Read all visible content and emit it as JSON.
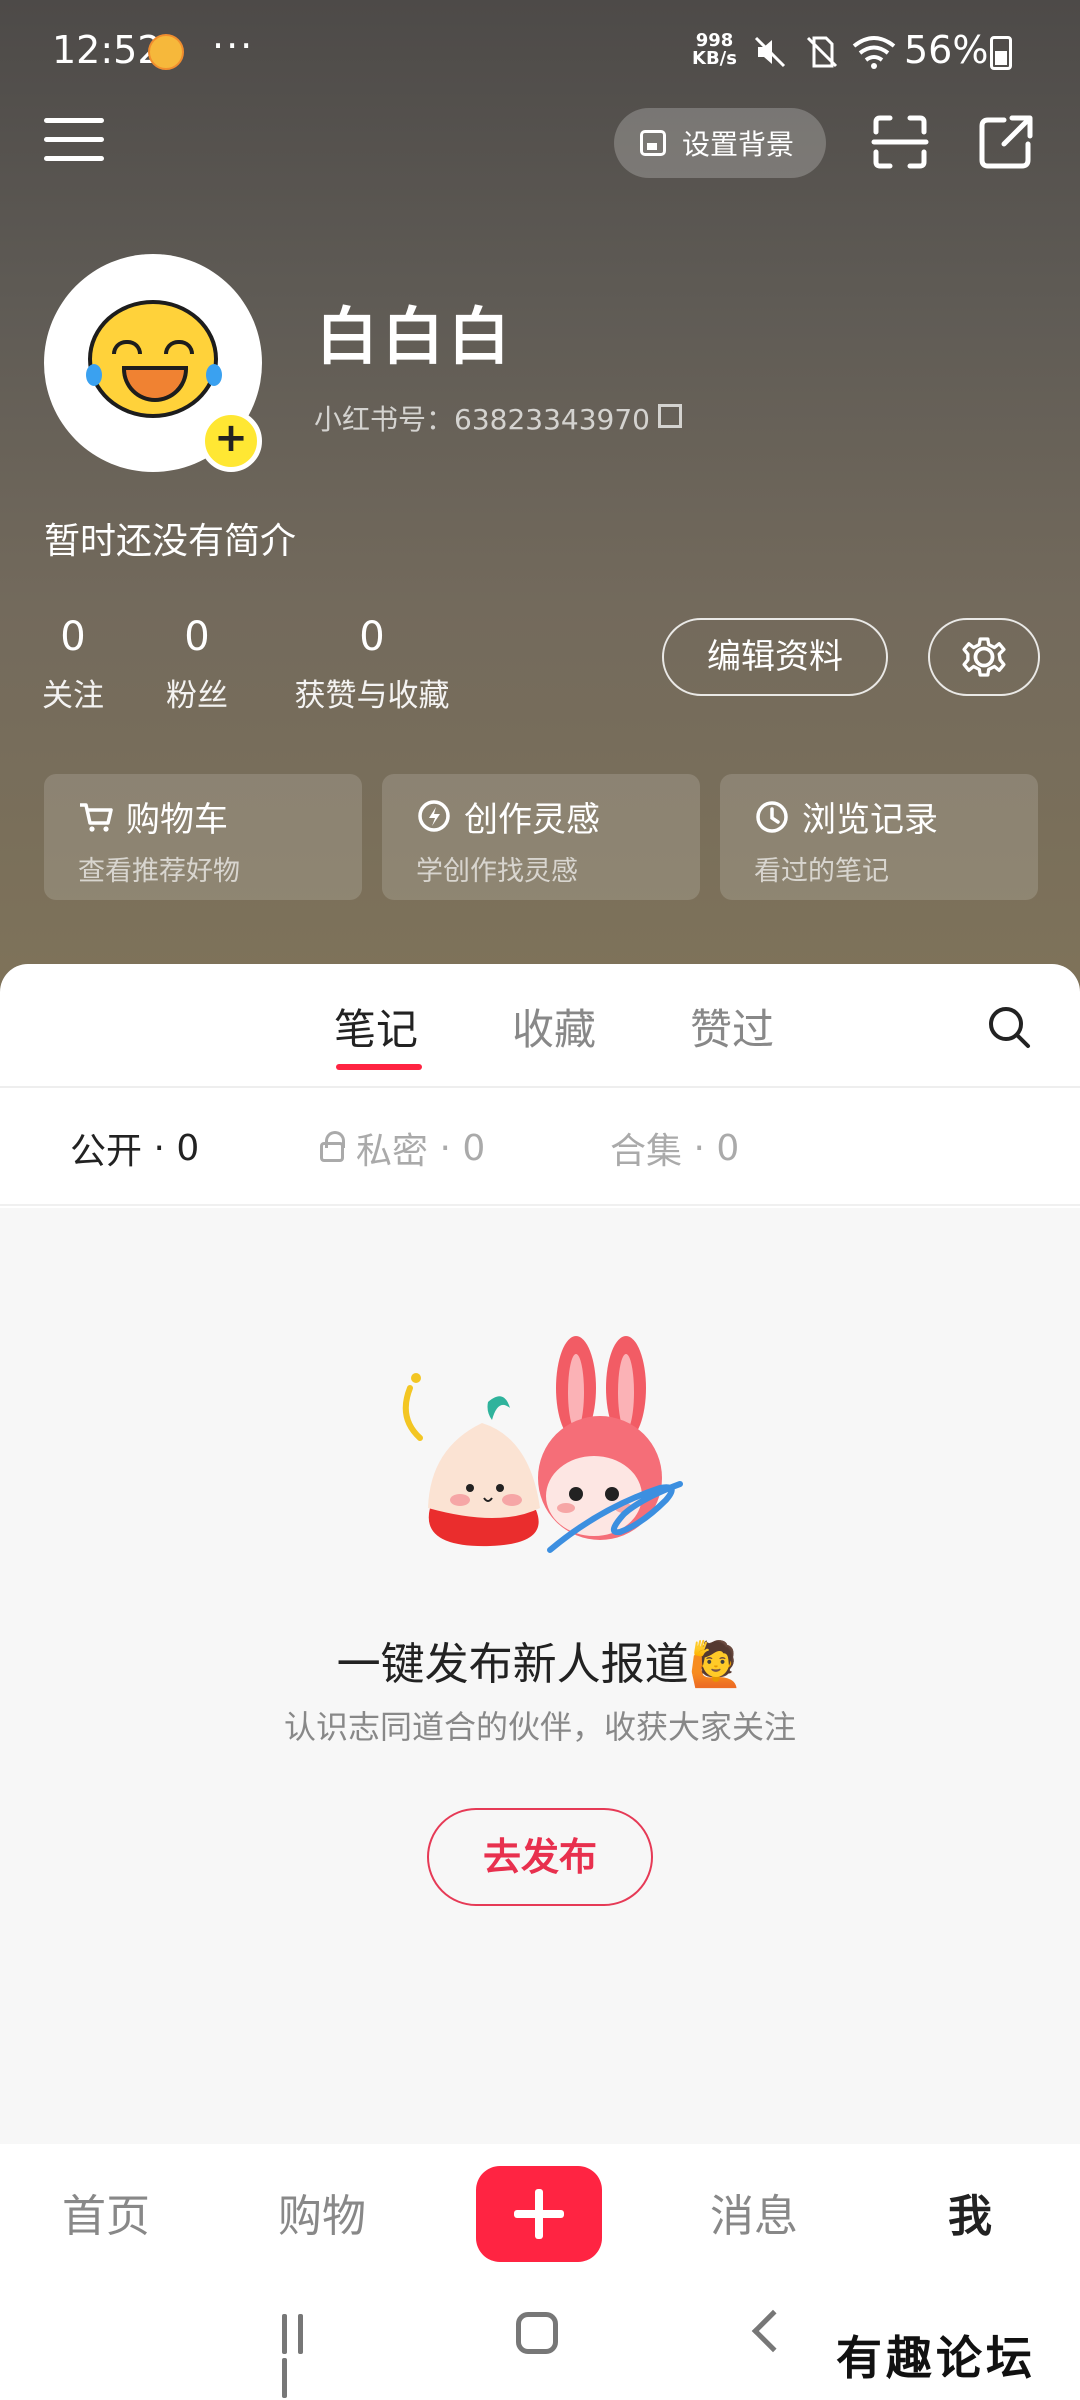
{
  "status_bar": {
    "time": "12:52",
    "dots": "···",
    "net_speed_value": "998",
    "net_speed_unit": "KB/s",
    "battery": "56%"
  },
  "header": {
    "set_background_label": "设置背景",
    "icons": [
      "menu-icon",
      "image-icon",
      "scan-icon",
      "share-icon"
    ]
  },
  "profile": {
    "username": "白白白",
    "id_label": "小红书号：63823343970",
    "bio": "暂时还没有简介",
    "stats": [
      {
        "count": "0",
        "label": "关注"
      },
      {
        "count": "0",
        "label": "粉丝"
      },
      {
        "count": "0",
        "label": "获赞与收藏"
      }
    ],
    "edit_label": "编辑资料"
  },
  "shortcuts": [
    {
      "title": "购物车",
      "subtitle": "查看推荐好物",
      "icon": "cart-icon"
    },
    {
      "title": "创作灵感",
      "subtitle": "学创作找灵感",
      "icon": "bulb-icon"
    },
    {
      "title": "浏览记录",
      "subtitle": "看过的笔记",
      "icon": "clock-icon"
    }
  ],
  "tabs": [
    {
      "label": "笔记",
      "active": true
    },
    {
      "label": "收藏",
      "active": false
    },
    {
      "label": "赞过",
      "active": false
    }
  ],
  "subtabs": [
    {
      "label": "公开",
      "count": "· 0"
    },
    {
      "label": "私密",
      "count": "· 0"
    },
    {
      "label": "合集",
      "count": "· 0"
    }
  ],
  "empty_state": {
    "title": "一键发布新人报道🙋",
    "subtitle": "认识志同道合的伙伴，收获大家关注",
    "button": "去发布"
  },
  "bottom_nav": [
    {
      "label": "首页",
      "active": false
    },
    {
      "label": "购物",
      "active": false
    },
    {
      "label": "消息",
      "active": false
    },
    {
      "label": "我",
      "active": true
    }
  ],
  "watermark": "有趣论坛",
  "colors": {
    "accent": "#ff2442",
    "publish_border": "#e63a56",
    "avatar_face": "#ffd23a"
  }
}
